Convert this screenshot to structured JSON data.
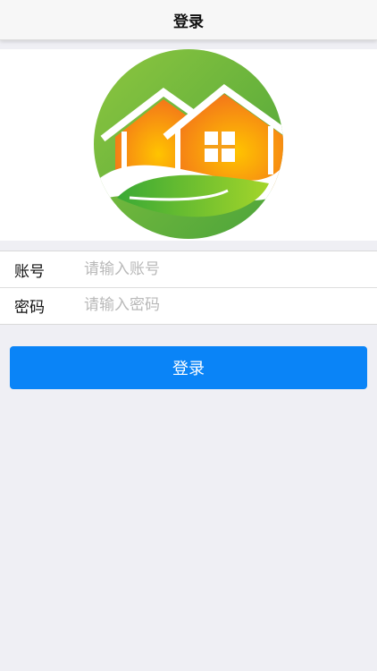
{
  "nav": {
    "title": "登录"
  },
  "logo": {
    "icon": "house-leaf-logo-icon"
  },
  "form": {
    "account": {
      "label": "账号",
      "placeholder": "请输入账号",
      "value": ""
    },
    "password": {
      "label": "密码",
      "placeholder": "请输入密码",
      "value": ""
    }
  },
  "login_button": {
    "label": "登录"
  },
  "colors": {
    "nav_bg": "#f7f7f7",
    "page_bg": "#efeff4",
    "button_bg": "#0a84f7",
    "logo_green": "#6dbb2f",
    "logo_orange": "#f28a13"
  }
}
